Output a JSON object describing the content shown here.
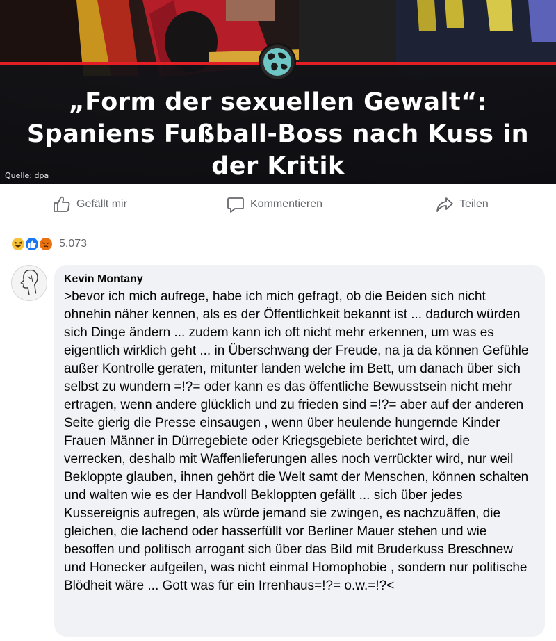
{
  "post": {
    "headline_lines": [
      "„Form der sexuellen Gewalt“:",
      "Spaniens Fußball-Boss nach Kuss in",
      "der Kritik"
    ],
    "image_source": "Quelle: dpa",
    "logo_icon": "globe-icon",
    "accent_color": "#e31e24"
  },
  "actions": {
    "like_label": "Gefällt mir",
    "comment_label": "Kommentieren",
    "share_label": "Teilen",
    "icons": [
      "thumbs-up-icon",
      "comment-bubble-icon",
      "share-arrow-icon"
    ]
  },
  "reactions": {
    "types": [
      "haha",
      "like",
      "angry"
    ],
    "count": "5.073"
  },
  "comment": {
    "author": "Kevin Montany",
    "text": ">bevor ich mich aufrege,  habe ich mich gefragt, ob die Beiden sich nicht ohnehin näher kennen, als es der Öffentlichkeit bekannt ist ... dadurch würden sich Dinge ändern ... zudem kann ich oft nicht mehr erkennen, um was es eigentlich wirklich geht ... in Überschwang der Freude, na ja da können Gefühle außer Kontrolle geraten, mitunter landen welche im Bett, um danach über sich selbst zu wundern  =!?= oder kann es das öffentliche Bewusstsein nicht mehr ertragen, wenn andere glücklich und zu frieden sind =!?= aber auf der anderen Seite gierig die Presse einsaugen , wenn über heulende hungernde Kinder Frauen Männer in Dürregebiete oder Kriegsgebiete berichtet wird, die verrecken, deshalb mit Waffenlieferungen alles noch verrückter wird, nur weil Bekloppte glauben, ihnen gehört die Welt samt der Menschen, können schalten und walten wie es der Handvoll Bekloppten gefällt ... sich über jedes Kussereignis aufregen, als würde jemand sie zwingen, es nachzuäffen, die gleichen, die lachend oder hasserfüllt vor Berliner Mauer stehen und wie besoffen und politisch arrogant sich über das Bild mit Bruderkuss Breschnew und Honecker aufgeilen, was nicht einmal Homophobie , sondern nur politische Blödheit wäre ... Gott was für ein Irrenhaus=!?= o.w.=!?<"
  }
}
